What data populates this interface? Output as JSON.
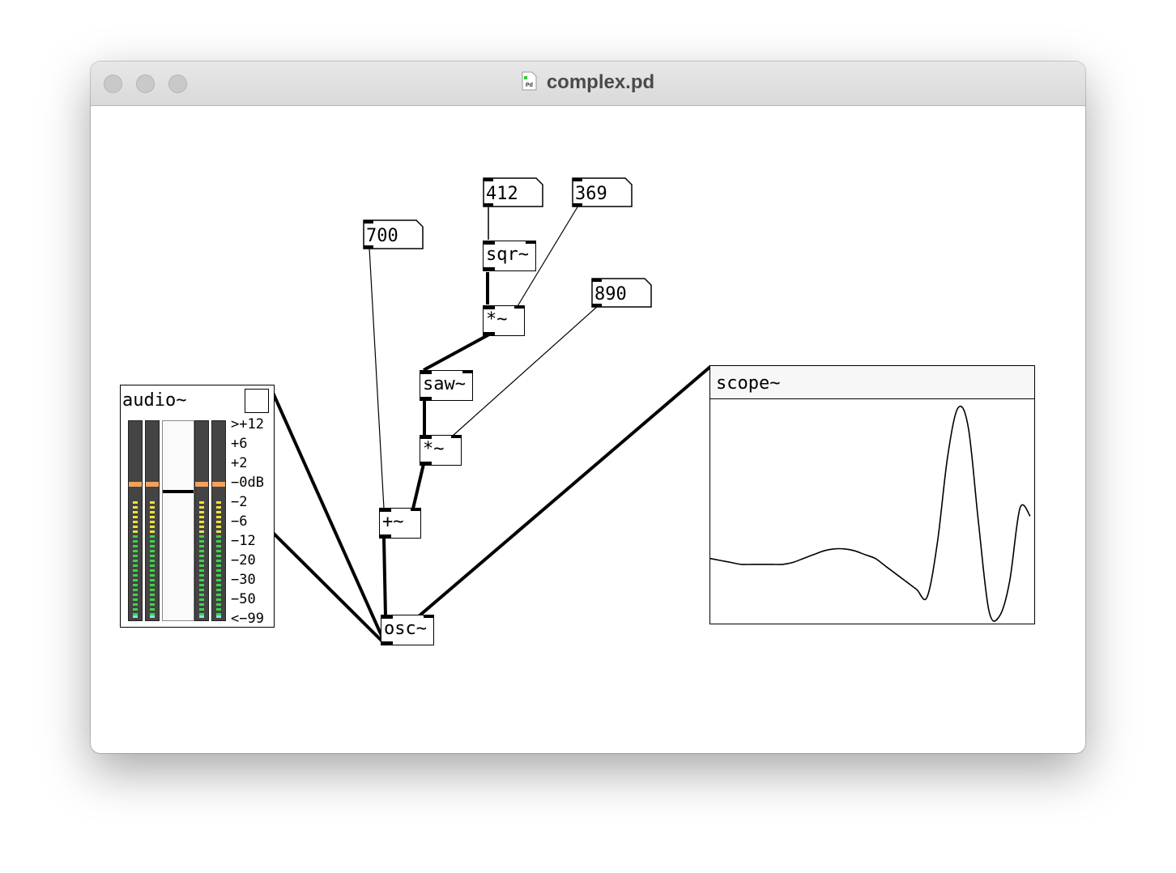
{
  "window": {
    "title": "complex.pd",
    "icon": "pd-document-icon"
  },
  "objects": {
    "sqr": "sqr~",
    "mul1": "*~",
    "saw": "saw~",
    "mul2": "*~",
    "add": "+~",
    "osc": "osc~"
  },
  "numbers": {
    "n412": "412",
    "n369": "369",
    "n700": "700",
    "n890": "890"
  },
  "audio": {
    "label": "audio~",
    "scale": [
      ">+12",
      "+6",
      "+2",
      "−0dB",
      "−2",
      "−6",
      "−12",
      "−20",
      "−30",
      "−50",
      "<−99"
    ],
    "meter_level_db": -2,
    "volume_level": 0.35
  },
  "scope": {
    "label": "scope~",
    "waveform": [
      0.22,
      0.21,
      0.2,
      0.19,
      0.19,
      0.19,
      0.19,
      0.19,
      0.2,
      0.22,
      0.24,
      0.26,
      0.27,
      0.27,
      0.26,
      0.24,
      0.22,
      0.18,
      0.14,
      0.1,
      0.06,
      0.02,
      0.3,
      0.75,
      1.0,
      0.9,
      0.4,
      -0.05,
      -0.08,
      0.1,
      0.48,
      0.44
    ]
  },
  "colors": {
    "meter_bg": "#444444",
    "meter_green": "#3fd24b",
    "meter_yellow": "#f0df3c",
    "meter_orange": "#f3a25a",
    "meter_cyan": "#7fe3f2"
  }
}
